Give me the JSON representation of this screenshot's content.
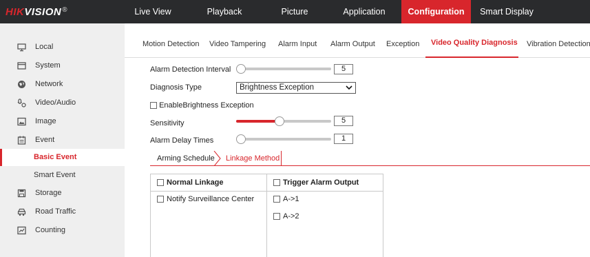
{
  "brand": {
    "hik": "HIK",
    "vision": "VISION",
    "reg": "®"
  },
  "topnav": {
    "items": [
      {
        "label": "Live View"
      },
      {
        "label": "Playback"
      },
      {
        "label": "Picture"
      },
      {
        "label": "Application"
      },
      {
        "label": "Configuration",
        "active": true
      },
      {
        "label": "Smart Display"
      }
    ]
  },
  "sidebar": {
    "items": [
      {
        "label": "Local",
        "icon": "monitor-icon"
      },
      {
        "label": "System",
        "icon": "system-icon"
      },
      {
        "label": "Network",
        "icon": "globe-icon"
      },
      {
        "label": "Video/Audio",
        "icon": "mic-camera-icon"
      },
      {
        "label": "Image",
        "icon": "image-icon"
      },
      {
        "label": "Event",
        "icon": "calendar-icon"
      },
      {
        "label": "Basic Event",
        "sub": true,
        "active": true
      },
      {
        "label": "Smart Event",
        "sub": true
      },
      {
        "label": "Storage",
        "icon": "floppy-icon"
      },
      {
        "label": "Road Traffic",
        "icon": "car-icon"
      },
      {
        "label": "Counting",
        "icon": "chart-icon"
      }
    ]
  },
  "subtabs": {
    "items": [
      {
        "label": "Motion Detection"
      },
      {
        "label": "Video Tampering"
      },
      {
        "label": "Alarm Input"
      },
      {
        "label": "Alarm Output"
      },
      {
        "label": "Exception"
      },
      {
        "label": "Video Quality Diagnosis",
        "active": true
      },
      {
        "label": "Vibration Detection"
      }
    ]
  },
  "form": {
    "alarm_interval": {
      "label": "Alarm Detection Interval",
      "value": "5",
      "level": 0
    },
    "diagnosis_type": {
      "label": "Diagnosis Type",
      "value": "Brightness Exception"
    },
    "enable": {
      "label": "EnableBrightness Exception"
    },
    "sensitivity": {
      "label": "Sensitivity",
      "value": "5",
      "level": 0.45
    },
    "delay_times": {
      "label": "Alarm Delay Times",
      "value": "1",
      "level": 0
    }
  },
  "schedule_tabs": {
    "arming": "Arming Schedule",
    "linkage": "Linkage Method"
  },
  "linkage": {
    "normal_header": "Normal Linkage",
    "trigger_header": "Trigger Alarm Output",
    "notify": "Notify Surveillance Center",
    "outputs": [
      "A->1",
      "A->2"
    ]
  },
  "colors": {
    "accent": "#d8262c",
    "topbar": "#2a2b2d",
    "sidebar": "#efefef"
  }
}
